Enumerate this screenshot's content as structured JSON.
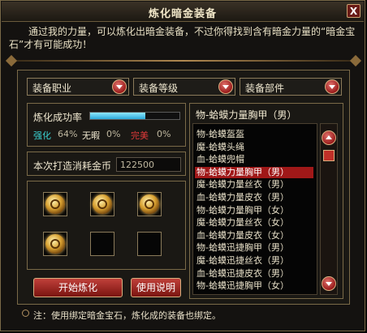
{
  "window": {
    "title": "炼化暗金装备",
    "close_label": "X"
  },
  "description": "通过我的力量，可以炼化出暗金装备，不过你得找到含有暗金力量的“暗金宝石”才有可能成功！",
  "selects": [
    {
      "label": "装备职业",
      "icon": "chevron-down-icon"
    },
    {
      "label": "装备等级",
      "icon": "chevron-down-icon"
    },
    {
      "label": "装备部件",
      "icon": "chevron-down-icon"
    }
  ],
  "success": {
    "label": "炼化成功率",
    "bar_fraction": 0.62,
    "stats": [
      {
        "label": "强化",
        "value": "64%",
        "label_color": "#3ad0d0"
      },
      {
        "label": "无暇",
        "value": "0%",
        "label_color": "#f0e8d0"
      },
      {
        "label": "完美",
        "value": "0%",
        "label_color": "#e03a3a"
      }
    ]
  },
  "cost": {
    "label": "本次打造消耗金币",
    "value": "122500"
  },
  "slots": {
    "filled": 4,
    "total": 6,
    "gem_icon": "dark-gold-gem-icon"
  },
  "buttons": {
    "start": "开始炼化",
    "help": "使用说明"
  },
  "equipment_list": {
    "header": "物-蛤蟆力量胸甲（男）",
    "items": [
      "物-蛤蟆盔盔",
      "魔-蛤蟆头绳",
      "血-蛤蟆兜帽",
      "物-蛤蟆力量胸甲（男）",
      "魔-蛤蟆力量丝衣（男）",
      "血-蛤蟆力量皮衣（男）",
      "物-蛤蟆力量胸甲（女）",
      "魔-蛤蟆力量丝衣（女）",
      "血-蛤蟆力量皮衣（女）",
      "物-蛤蟆迅捷胸甲（男）",
      "魔-蛤蟆迅捷丝衣（男）",
      "血-蛤蟆迅捷皮衣（男）",
      "物-蛤蟆迅捷胸甲（女）"
    ],
    "selected_index": 3
  },
  "note": "注：使用绑定暗金宝石，炼化成的装备也绑定。"
}
